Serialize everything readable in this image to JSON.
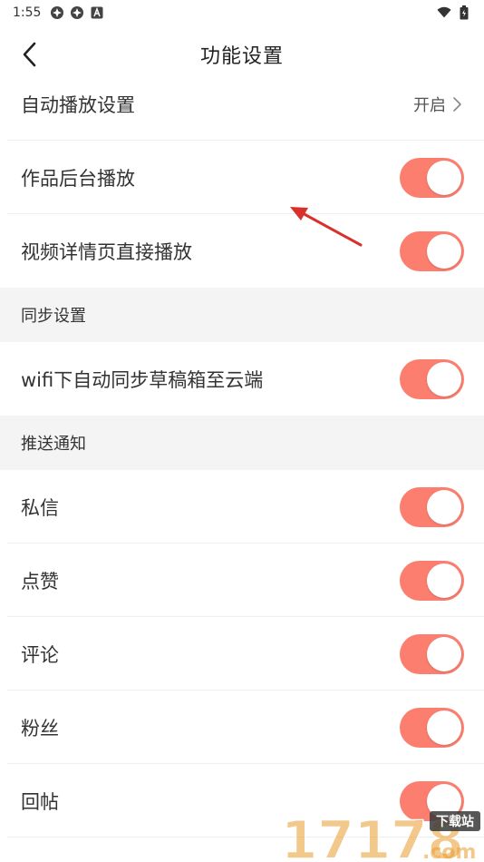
{
  "status_bar": {
    "time": "1:55"
  },
  "header": {
    "title": "功能设置"
  },
  "rows": {
    "autoplay": {
      "label": "自动播放设置",
      "value": "开启"
    },
    "background_play": {
      "label": "作品后台播放",
      "on": true
    },
    "video_direct_play": {
      "label": "视频详情页直接播放",
      "on": true
    }
  },
  "sections": {
    "sync": "同步设置",
    "push": "推送通知"
  },
  "sync_rows": {
    "wifi_sync": {
      "label": "wifi下自动同步草稿箱至云端",
      "on": true
    }
  },
  "push_rows": {
    "private_msg": {
      "label": "私信",
      "on": true
    },
    "likes": {
      "label": "点赞",
      "on": true
    },
    "comments": {
      "label": "评论",
      "on": true
    },
    "fans": {
      "label": "粉丝",
      "on": true
    },
    "reply_posts": {
      "label": "回帖",
      "on": true
    }
  },
  "colors": {
    "toggle_on": "#fb7e6f",
    "section_bg": "#f4f4f4",
    "annotation_arrow": "#d9302c",
    "watermark_orange": "#e99a2c"
  },
  "watermark": {
    "digits": "17178",
    "suffix": ".com",
    "badge": "下载站"
  }
}
